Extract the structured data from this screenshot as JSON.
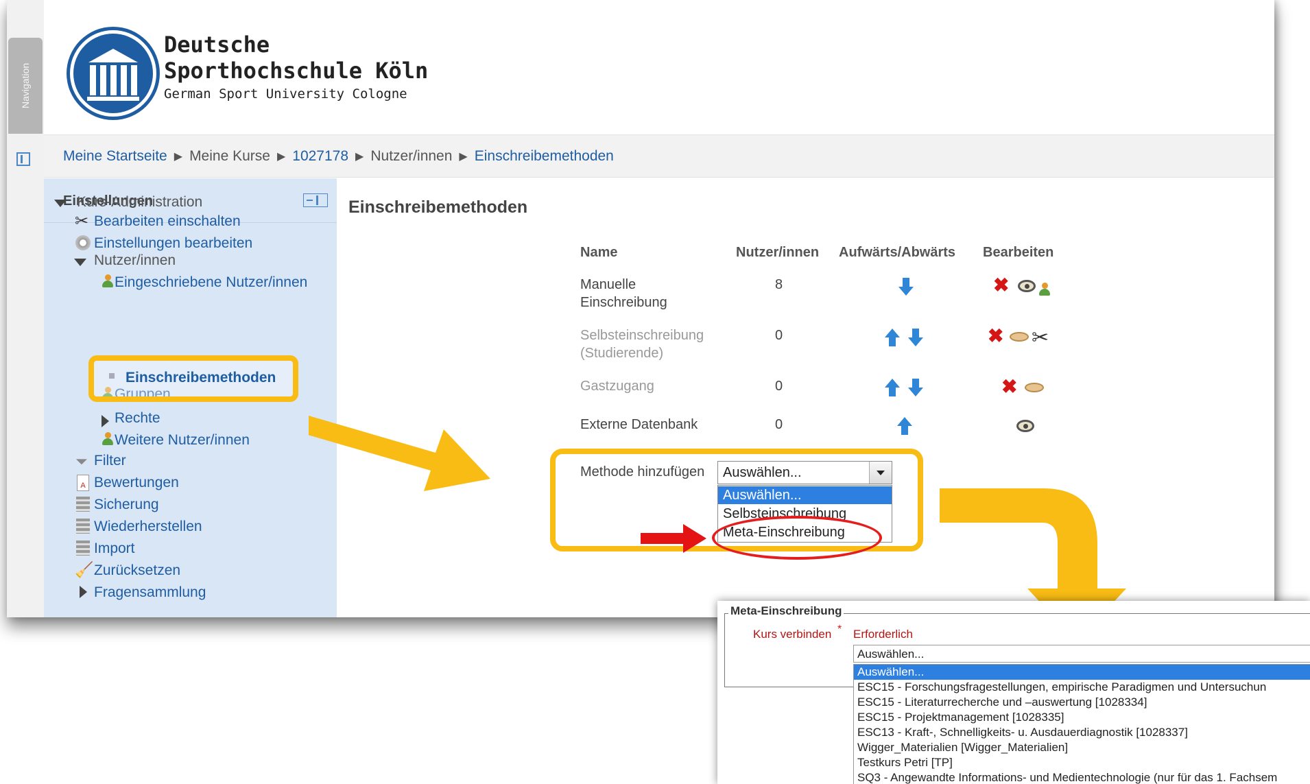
{
  "nav": {
    "tab_label": "Navigation"
  },
  "brand": {
    "line1": "Deutsche",
    "line2": "Sporthochschule Köln",
    "line3": "German Sport University Cologne"
  },
  "breadcrumb": [
    "Meine Startseite",
    "Meine Kurse",
    "1027178",
    "Nutzer/innen",
    "Einschreibemethoden"
  ],
  "settings": {
    "title": "Einstellungen",
    "items": [
      "Kurs-Administration",
      "Bearbeiten einschalten",
      "Einstellungen bearbeiten",
      "Nutzer/innen",
      "Eingeschriebene Nutzer/innen",
      "Einschreibemethoden",
      "Gruppen",
      "Rechte",
      "Weitere Nutzer/innen",
      "Filter",
      "Bewertungen",
      "Sicherung",
      "Wiederherstellen",
      "Import",
      "Zurücksetzen",
      "Fragensammlung"
    ]
  },
  "main": {
    "title": "Einschreibemethoden",
    "columns": [
      "Name",
      "Nutzer/innen",
      "Aufwärts/Abwärts",
      "Bearbeiten"
    ],
    "rows": [
      {
        "name_line1": "Manuelle",
        "name_line2": "Einschreibung",
        "users": "8"
      },
      {
        "name_line1": "Selbsteinschreibung",
        "name_line2": "(Studierende)",
        "users": "0"
      },
      {
        "name_line1": "Gastzugang",
        "name_line2": "",
        "users": "0"
      },
      {
        "name_line1": "Externe Datenbank",
        "name_line2": "",
        "users": "0"
      }
    ],
    "add_method": {
      "label": "Methode hinzufügen",
      "selected": "Auswählen...",
      "options": [
        "Auswählen...",
        "Selbsteinschreibung",
        "Meta-Einschreibung"
      ]
    }
  },
  "meta": {
    "legend": "Meta-Einschreibung",
    "field_label": "Kurs verbinden",
    "required_mark": "*",
    "required_text": "Erforderlich",
    "selected": "Auswählen...",
    "options": [
      "Auswählen...",
      "ESC15 - Forschungsfragestellungen, empirische Paradigmen und Untersuchun",
      "ESC15 - Literaturrecherche und –auswertung [1028334]",
      "ESC15 - Projektmanagement [1028335]",
      "ESC13 - Kraft-, Schnelligkeits- u. Ausdauerdiagnostik [1028337]",
      "Wigger_Materialien [Wigger_Materialien]",
      "Testkurs Petri [TP]",
      "SQ3 - Angewandte Informations- und Medientechnologie (nur für das 1. Fachsem"
    ]
  },
  "colors": {
    "link": "#1f5da3",
    "highlight": "#f8bc14",
    "selected_option": "#2d7fe0",
    "required": "#b41414"
  }
}
